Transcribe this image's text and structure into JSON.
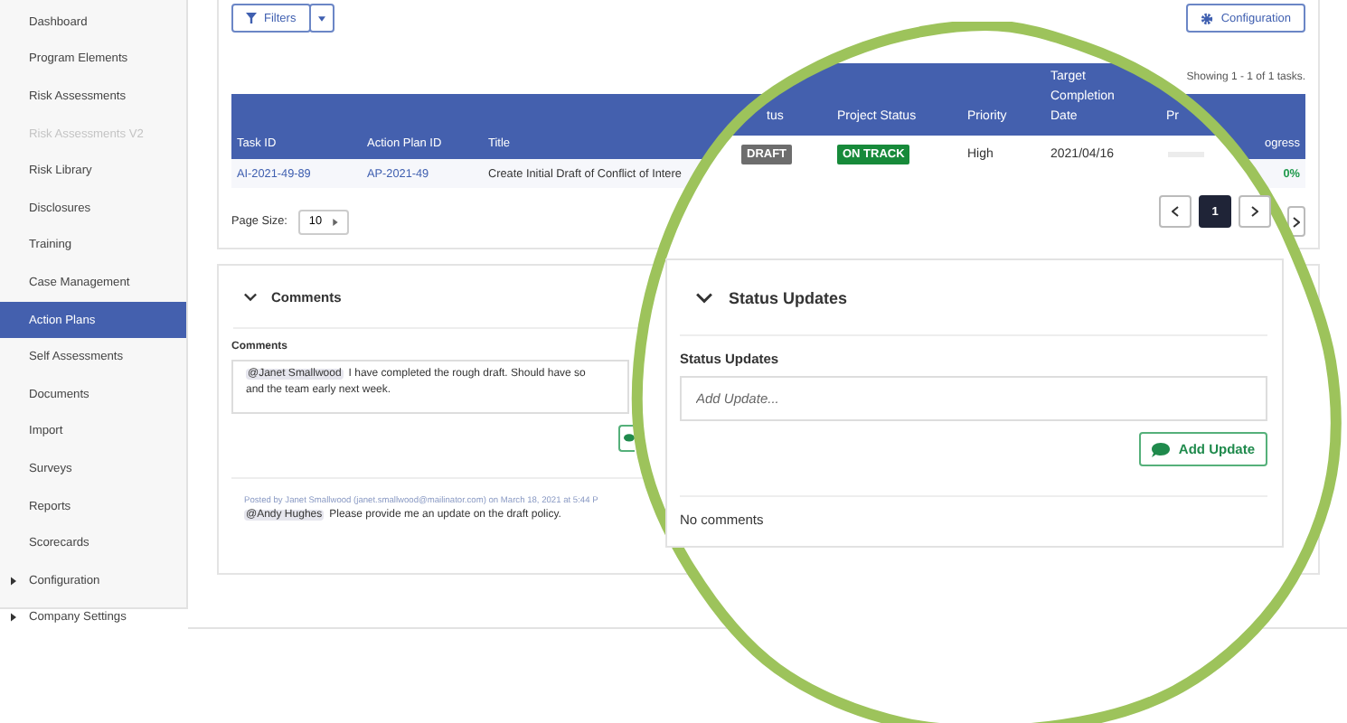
{
  "sidebar": {
    "items": [
      {
        "label": "Dashboard",
        "kind": "link",
        "selected": false,
        "disabled": false
      },
      {
        "label": "Program Elements",
        "kind": "link",
        "selected": false,
        "disabled": false
      },
      {
        "label": "Risk Assessments",
        "kind": "link",
        "selected": false,
        "disabled": false
      },
      {
        "label": "Risk Assessments V2",
        "kind": "link",
        "selected": false,
        "disabled": true
      },
      {
        "label": "Risk Library",
        "kind": "link",
        "selected": false,
        "disabled": false
      },
      {
        "label": "Disclosures",
        "kind": "link",
        "selected": false,
        "disabled": false
      },
      {
        "label": "Training",
        "kind": "link",
        "selected": false,
        "disabled": false
      },
      {
        "label": "Case Management",
        "kind": "link",
        "selected": false,
        "disabled": false
      },
      {
        "label": "Action Plans",
        "kind": "link",
        "selected": true,
        "disabled": false
      },
      {
        "label": "Self Assessments",
        "kind": "link",
        "selected": false,
        "disabled": false
      },
      {
        "label": "Documents",
        "kind": "link",
        "selected": false,
        "disabled": false
      },
      {
        "label": "Import",
        "kind": "link",
        "selected": false,
        "disabled": false
      },
      {
        "label": "Surveys",
        "kind": "link",
        "selected": false,
        "disabled": false
      },
      {
        "label": "Reports",
        "kind": "link",
        "selected": false,
        "disabled": false
      },
      {
        "label": "Scorecards",
        "kind": "link",
        "selected": false,
        "disabled": false
      },
      {
        "label": "Configuration",
        "kind": "group",
        "selected": false,
        "disabled": false,
        "expanded": false
      },
      {
        "label": "Company Settings",
        "kind": "group",
        "selected": false,
        "disabled": false,
        "expanded": false
      }
    ]
  },
  "toolbar": {
    "filters_button": "Filters",
    "configuration_button": "Configuration"
  },
  "tasks": {
    "summary": "Showing 1 - 1 of 1 tasks.",
    "columns": [
      "Task ID",
      "Action Plan ID",
      "Title",
      "ogress"
    ],
    "rows": [
      {
        "task_id": "AI-2021-49-89",
        "action_plan_id": "AP-2021-49",
        "title": "Create Initial Draft of Conflict of Intere",
        "progress": "0%"
      }
    ],
    "page_size_label": "Page Size:",
    "page_size": "10"
  },
  "magnifier": {
    "columns": [
      "tus",
      "Project Status",
      "Priority",
      "Target Completion Date",
      "Pr"
    ],
    "row": {
      "status": "DRAFT",
      "project_status": "ON TRACK",
      "priority": "High",
      "target_date": "2021/04/16",
      "level": 0
    },
    "pages": [
      {
        "label": "1",
        "selected": true
      }
    ],
    "card": {
      "title": "Status Updates",
      "expanded": true,
      "field_label": "Status Updates",
      "placeholder": "Add Update...",
      "button": "Add Update",
      "empty_text": "No comments"
    }
  },
  "comments": {
    "title": "Comments",
    "expanded": true,
    "field_label": "Comments",
    "draft": {
      "mention": "@Janet Smallwood",
      "lines": [
        "I have completed the rough draft.  Should have so",
        "and the team early next week."
      ]
    },
    "posts": [
      {
        "meta": "Posted by Janet Smallwood (janet.smallwood@mailinator.com) on March 18, 2021 at 5:44 P",
        "mention": "@Andy Hughes",
        "text": "Please provide me an update on the draft policy."
      }
    ]
  }
}
